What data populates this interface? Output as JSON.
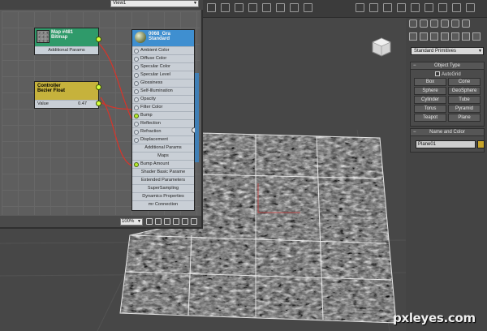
{
  "material_editor": {
    "view_dropdown": "View1",
    "zoom": "100%",
    "nodes": {
      "bitmap": {
        "title": "Map #481",
        "subtitle": "Bitmap",
        "row": "Additional Params"
      },
      "controller": {
        "title": "Controller",
        "subtitle": "Bezier Float",
        "value_label": "Value",
        "value": "0.47"
      },
      "material": {
        "title": "0068_Gra",
        "subtitle": "Standard",
        "slots": [
          "Ambient Color",
          "Diffuse Color",
          "Specular Color",
          "Specular Level",
          "Glossiness",
          "Self-Illumination",
          "Opacity",
          "Filter Color",
          "Bump",
          "Reflection",
          "Refraction",
          "Displacement"
        ],
        "group1": "Additional Params",
        "group2": "Maps",
        "bump_amount": "Bump Amount",
        "rollouts": [
          "Shader Basic Parame",
          "Extended Parameters",
          "SuperSampling",
          "Dynamics Properties",
          "mr Connection"
        ]
      }
    }
  },
  "command_panel": {
    "category_dropdown": "Standard Primitives",
    "object_type": {
      "header": "Object Type",
      "autogrid": "AutoGrid",
      "buttons": [
        "Box",
        "Cone",
        "Sphere",
        "GeoSphere",
        "Cylinder",
        "Tube",
        "Torus",
        "Pyramid",
        "Teapot",
        "Plane"
      ]
    },
    "name_and_color": {
      "header": "Name and Color",
      "name": "Plane01",
      "color": "#c7a42a"
    }
  },
  "watermark": "pxleyes.com"
}
